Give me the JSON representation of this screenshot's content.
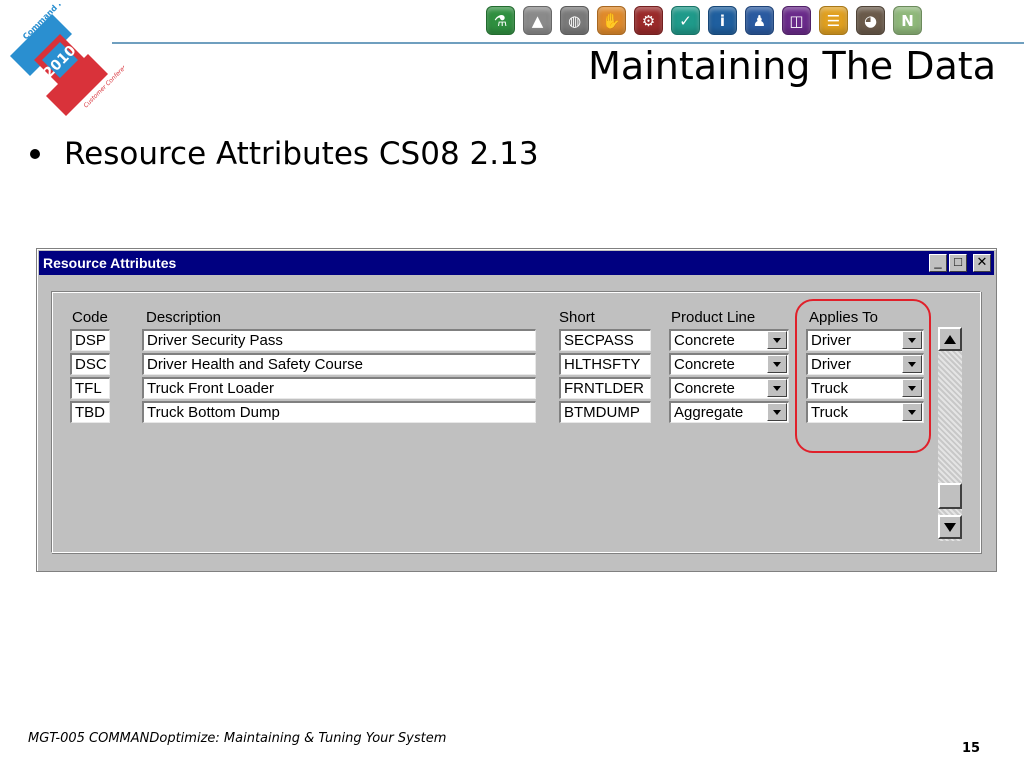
{
  "logo": {
    "brand_text": "Command Alkon",
    "year": "2010",
    "event_text": "Customer Conference",
    "colors": {
      "red": "#d9323a",
      "blue": "#2a8fd0"
    }
  },
  "toolbar_icons": [
    {
      "name": "flask-icon",
      "color": "#2f8f3f",
      "glyph": "⚗"
    },
    {
      "name": "road-icon",
      "color": "#8a8a8a",
      "glyph": "▲"
    },
    {
      "name": "globe-icon",
      "color": "#7a7a7a",
      "glyph": "◍"
    },
    {
      "name": "hand-icon",
      "color": "#e08a2a",
      "glyph": "✋"
    },
    {
      "name": "gears-icon",
      "color": "#9a2a2a",
      "glyph": "⚙"
    },
    {
      "name": "checkmark-icon",
      "color": "#1f9a8a",
      "glyph": "✓"
    },
    {
      "name": "info-icon",
      "color": "#1f5f9f",
      "glyph": "i"
    },
    {
      "name": "presenter-icon",
      "color": "#2a5aa0",
      "glyph": "♟"
    },
    {
      "name": "layout-icon",
      "color": "#6a2a8a",
      "glyph": "◫"
    },
    {
      "name": "list-icon",
      "color": "#e0a020",
      "glyph": "☰"
    },
    {
      "name": "truck-icon",
      "color": "#6a5a4a",
      "glyph": "◕"
    },
    {
      "name": "letter-n-icon",
      "color": "#8fb87a",
      "glyph": "N"
    }
  ],
  "slide": {
    "title": "Maintaining The Data",
    "bullet": "Resource Attributes CS08 2.13"
  },
  "window": {
    "title": "Resource Attributes",
    "controls": {
      "minimize": "_",
      "maximize": "□",
      "close": "✕"
    },
    "columns": {
      "code": "Code",
      "description": "Description",
      "short": "Short",
      "product_line": "Product Line",
      "applies_to": "Applies To"
    },
    "rows": [
      {
        "code": "DSP",
        "description": "Driver Security Pass",
        "short": "SECPASS",
        "product_line": "Concrete",
        "applies_to": "Driver"
      },
      {
        "code": "DSC",
        "description": "Driver Health and Safety Course",
        "short": "HLTHSFTY",
        "product_line": "Concrete",
        "applies_to": "Driver"
      },
      {
        "code": "TFL",
        "description": "Truck Front Loader",
        "short": "FRNTLDER",
        "product_line": "Concrete",
        "applies_to": "Truck"
      },
      {
        "code": "TBD",
        "description": "Truck Bottom Dump",
        "short": "BTMDUMP",
        "product_line": "Aggregate",
        "applies_to": "Truck"
      }
    ],
    "highlight_color": "#e0202a"
  },
  "footer": {
    "text": "MGT-005 COMMANDoptimize: Maintaining & Tuning Your System",
    "page_number": "15"
  }
}
